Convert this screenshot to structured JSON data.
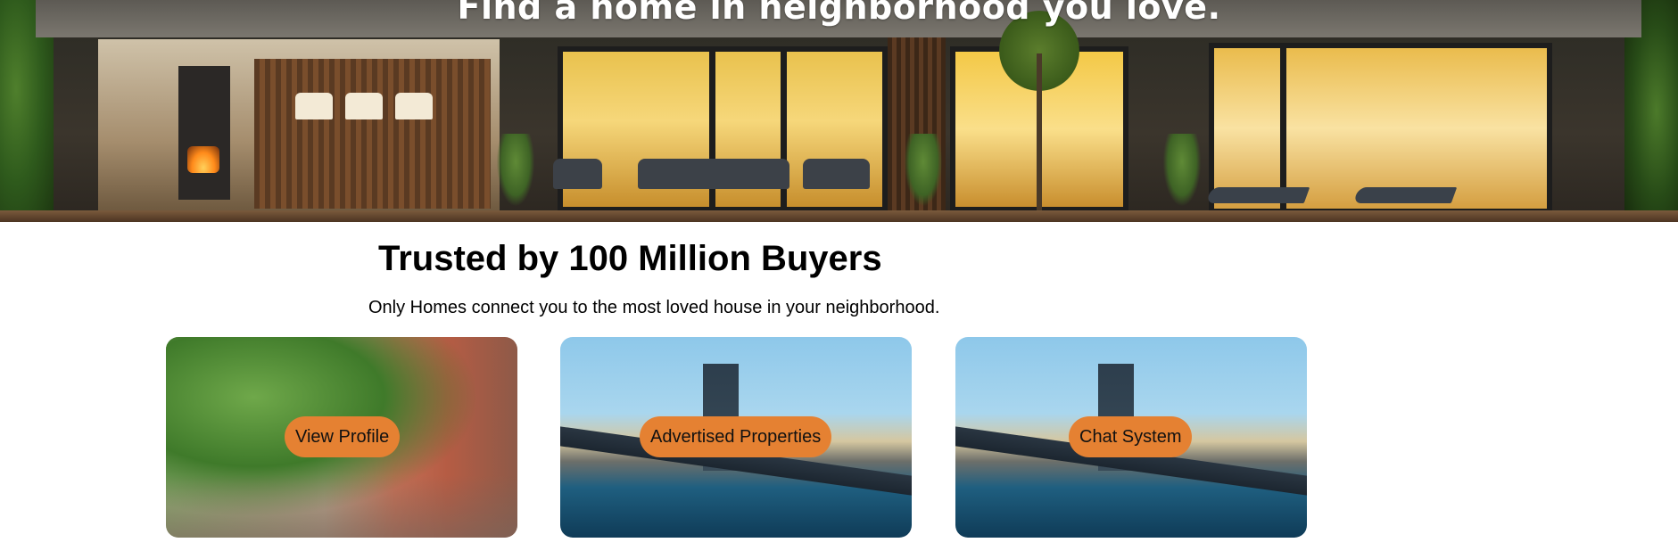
{
  "hero": {
    "title": "Find a home in neighborhood you love."
  },
  "intro": {
    "title": "Trusted by 100 Million Buyers",
    "subtitle": "Only Homes connect you to the most loved house in your neighborhood."
  },
  "cards": [
    {
      "button_label": "View Profile",
      "image": "street-trees-brownstone"
    },
    {
      "button_label": "Advertised Properties",
      "image": "bridge-cityscape"
    },
    {
      "button_label": "Chat System",
      "image": "bridge-cityscape"
    }
  ],
  "colors": {
    "button": "#e58132",
    "title_text": "#000000",
    "hero_text": "#ffffff"
  }
}
